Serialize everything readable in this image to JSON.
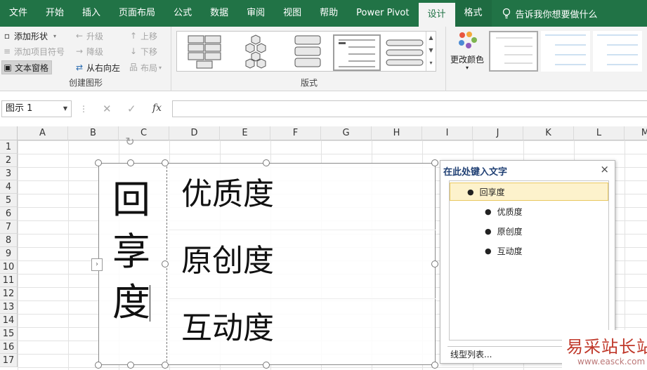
{
  "ribbon_tabs": [
    "文件",
    "开始",
    "插入",
    "页面布局",
    "公式",
    "数据",
    "审阅",
    "视图",
    "帮助",
    "Power Pivot",
    "设计",
    "格式"
  ],
  "tell_me": "告诉我你想要做什么",
  "create_group": {
    "add_shape": "添加形状",
    "add_bullet": "添加项目符号",
    "text_pane": "文本窗格",
    "promote": "升级",
    "demote": "降级",
    "right_to_left": "从右向左",
    "move_up": "上移",
    "move_down": "下移",
    "layout": "布局",
    "label": "创建图形"
  },
  "layout_group": {
    "label": "版式"
  },
  "change_colors": "更改颜色",
  "formula_bar": {
    "name_box": "图示 1",
    "cancel_icon": "✕",
    "enter_icon": "✓",
    "function_icon": "fx",
    "formula_value": ""
  },
  "columns": [
    "A",
    "B",
    "C",
    "D",
    "E",
    "F",
    "G",
    "H",
    "I",
    "J",
    "K",
    "L",
    "M"
  ],
  "rows": [
    "1",
    "2",
    "3",
    "4",
    "5",
    "6",
    "7",
    "8",
    "9",
    "10",
    "11",
    "12",
    "13",
    "14",
    "15",
    "16",
    "17"
  ],
  "smartart": {
    "main_chars": [
      "回",
      "享",
      "度"
    ],
    "sub_items": [
      "优质度",
      "原创度",
      "互动度"
    ],
    "expand_icon": "›"
  },
  "text_pane": {
    "title": "在此处键入文字",
    "close": "×",
    "items": [
      {
        "level": 0,
        "text": "回享度"
      },
      {
        "level": 1,
        "text": "优质度"
      },
      {
        "level": 1,
        "text": "原创度"
      },
      {
        "level": 1,
        "text": "互动度"
      }
    ],
    "footer": "线型列表..."
  },
  "watermark": {
    "text": "易采站长站",
    "url": "www.easck.com"
  },
  "colors": {
    "ribbon_green": "#217346",
    "selected_item": "#fdf2cc",
    "pane_title": "#1f3f73"
  }
}
